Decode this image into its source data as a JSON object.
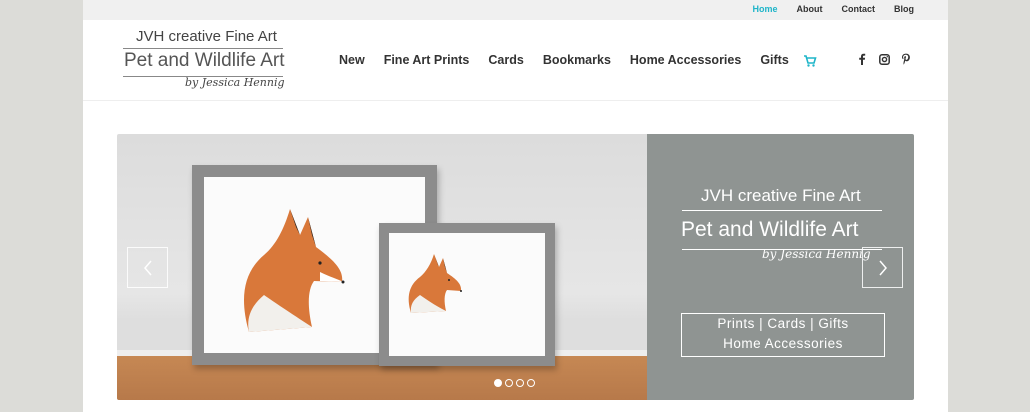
{
  "top_nav": {
    "links": [
      "Home",
      "About",
      "Contact",
      "Blog"
    ]
  },
  "logo": {
    "line1": "JVH creative Fine Art",
    "line2": "Pet and Wildlife Art",
    "line3": "by Jessica Hennig"
  },
  "main_nav": {
    "items": [
      "New",
      "Fine Art Prints",
      "Cards",
      "Bookmarks",
      "Home Accessories",
      "Gifts"
    ]
  },
  "icons": {
    "cart": "cart-icon",
    "social": [
      "facebook-icon",
      "instagram-icon",
      "pinterest-icon"
    ]
  },
  "colors": {
    "accent": "#1fb5c9",
    "panel": "#8f9492",
    "frame": "#8c8c8c"
  },
  "slide": {
    "title1": "JVH creative Fine Art",
    "title2": "Pet and Wildlife Art",
    "signature": "by Jessica Hennig",
    "tagline1": "Prints | Cards | Gifts",
    "tagline2": "Home Accessories"
  },
  "slider": {
    "slide_count": 4,
    "active_slide": 1
  }
}
